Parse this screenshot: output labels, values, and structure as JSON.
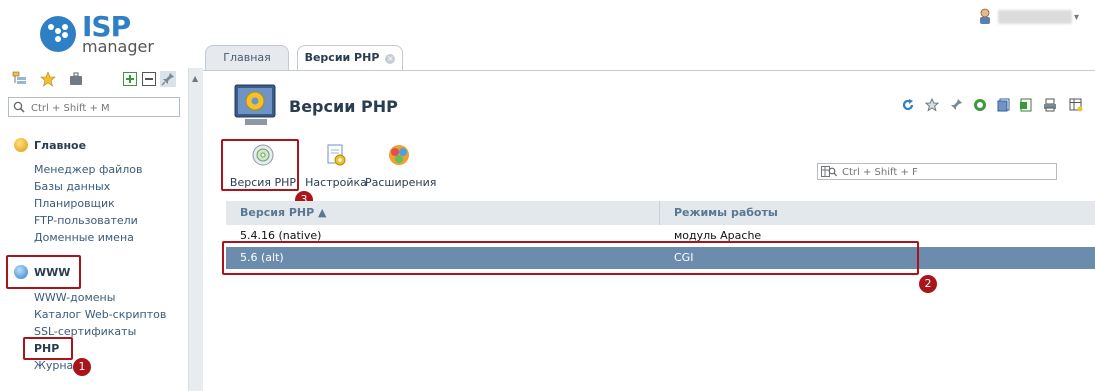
{
  "logo": {
    "line1": "ISP",
    "line2": "manager",
    "brand_color": "#2f7fc5"
  },
  "user": {
    "caret": "▾"
  },
  "sidebar": {
    "search_placeholder": "Ctrl + Shift + M",
    "sections": [
      {
        "title": "Главное",
        "items": [
          "Менеджер файлов",
          "Базы данных",
          "Планировщик",
          "FTP-пользователи",
          "Доменные имена"
        ]
      },
      {
        "title": "WWW",
        "items": [
          "WWW-домены",
          "Каталог Web-скриптов",
          "SSL-сертификаты",
          "PHP",
          "Журналы"
        ]
      }
    ]
  },
  "tabs": [
    {
      "label": "Главная",
      "active": false
    },
    {
      "label": "Версии PHP",
      "active": true,
      "close": "×"
    }
  ],
  "page": {
    "title": "Версии PHP"
  },
  "toolbar": {
    "buttons": [
      {
        "label": "Версия PHP",
        "icon": "cd-disc-icon"
      },
      {
        "label": "Настройка",
        "icon": "settings-icon"
      },
      {
        "label": "Расширения",
        "icon": "extensions-icon"
      }
    ],
    "filter_placeholder": "Ctrl + Shift + F"
  },
  "table": {
    "columns": [
      "Версия PHP ▲",
      "Режимы работы"
    ],
    "rows": [
      [
        "5.4.16 (native)",
        "модуль Apache"
      ],
      [
        "5.6 (alt)",
        "CGI"
      ]
    ],
    "selected_row": 1,
    "selected_color": "#6b8cad"
  },
  "annotations": [
    "1",
    "2",
    "3"
  ],
  "highlight_color": "#a8151a"
}
